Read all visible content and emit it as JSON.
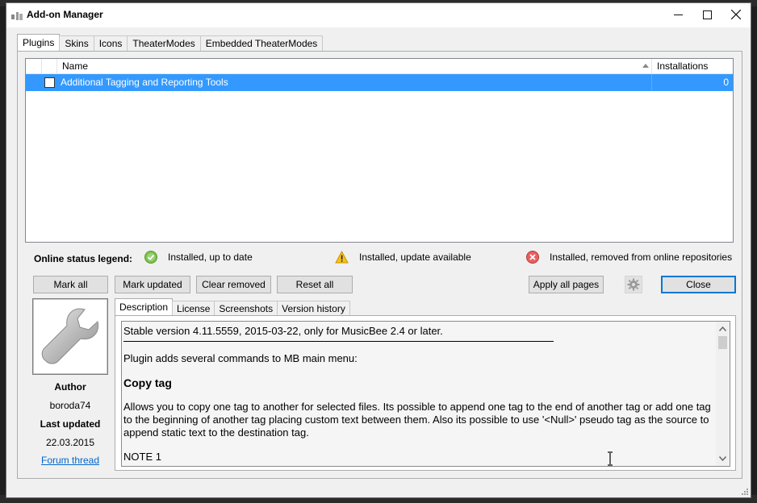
{
  "window": {
    "title": "Add-on Manager"
  },
  "tabs": [
    {
      "label": "Plugins",
      "active": true
    },
    {
      "label": "Skins"
    },
    {
      "label": "Icons"
    },
    {
      "label": "TheaterModes"
    },
    {
      "label": "Embedded TheaterModes"
    }
  ],
  "list": {
    "columns": {
      "name": "Name",
      "installations": "Installations"
    },
    "rows": [
      {
        "name": "Additional Tagging and Reporting Tools",
        "installations": "0",
        "checked": false,
        "selected": true
      }
    ]
  },
  "legend": {
    "title": "Online status legend:",
    "items": [
      {
        "icon": "check-circle-icon",
        "label": "Installed, up to date",
        "color": "#6cbf3a"
      },
      {
        "icon": "warning-triangle-icon",
        "label": "Installed, update available",
        "color": "#f5b800"
      },
      {
        "icon": "error-circle-icon",
        "label": "Installed, removed from online repositories",
        "color": "#e05a5a"
      }
    ]
  },
  "buttons": {
    "mark_all": "Mark all",
    "mark_updated": "Mark updated",
    "clear_removed": "Clear removed",
    "reset_all": "Reset all",
    "apply_all_pages": "Apply all pages",
    "close": "Close"
  },
  "info": {
    "author_label": "Author",
    "author": "boroda74",
    "last_updated_label": "Last updated",
    "last_updated": "22.03.2015",
    "forum_link": "Forum thread"
  },
  "detail_tabs": [
    {
      "label": "Description",
      "active": true
    },
    {
      "label": "License"
    },
    {
      "label": "Screenshots"
    },
    {
      "label": "Version history"
    }
  ],
  "description": {
    "version_line": "Stable version 4.11.5559, 2015-03-22, only for MusicBee 2.4 or later.",
    "intro": "Plugin adds several commands to MB main menu:",
    "heading": "Copy tag",
    "body": "Allows you to copy one tag to another for selected files. Its possible to append one tag to the end of another tag or add one tag to the beginning of another tag placing custom text between them. Also its possible to use '<Null>' pseudo tag as the source to append static text to the destination tag.",
    "cut_line": "NOTE 1"
  },
  "colors": {
    "selection": "#3399ff",
    "primary_border": "#0078d7",
    "link": "#0066cc"
  }
}
